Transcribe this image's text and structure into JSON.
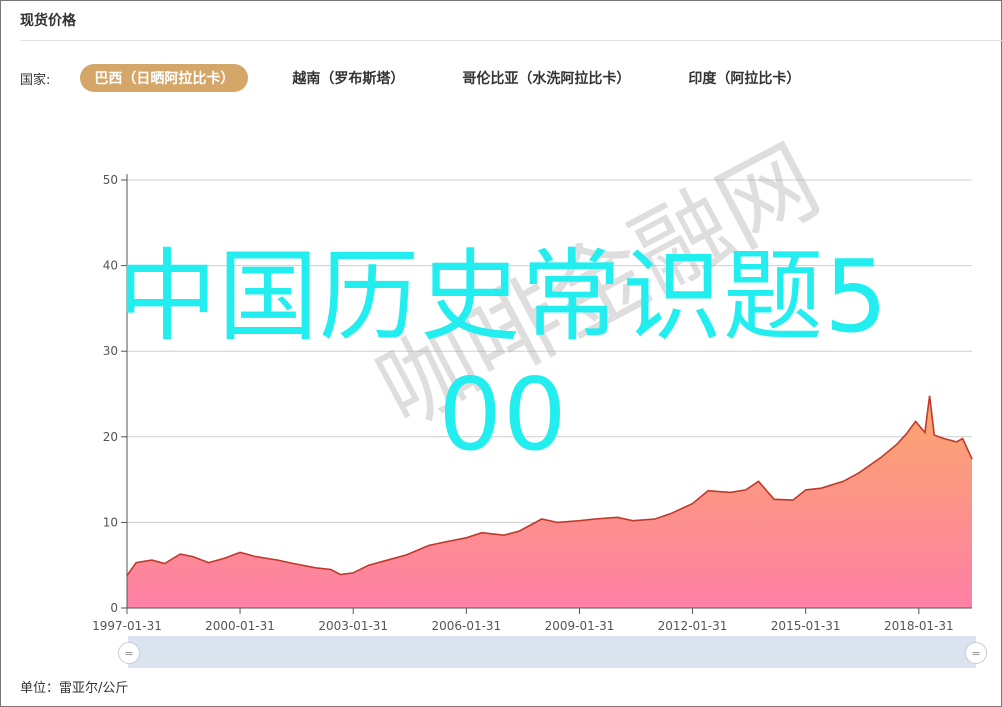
{
  "page": {
    "title": "现货价格",
    "filter_label": "国家:",
    "countries": [
      {
        "label": "巴西（日晒阿拉比卡）",
        "active": true
      },
      {
        "label": "越南（罗布斯塔）",
        "active": false
      },
      {
        "label": "哥伦比亚（水洗阿拉比卡）",
        "active": false
      },
      {
        "label": "印度（阿拉比卡）",
        "active": false
      }
    ],
    "unit": "单位：雷亚尔/公斤",
    "overlay_line1": "中国历史常识题5",
    "overlay_line2": "00",
    "watermark": "咖啡金融网"
  },
  "colors": {
    "accent": "#d4a668",
    "line": "#c0392b",
    "area_top": "#f9a76b",
    "area_bottom": "#ff7fa6",
    "overlay_text": "#22eef0"
  },
  "chart_data": {
    "type": "area",
    "ylim": [
      0,
      50
    ],
    "yticks": [
      0,
      10,
      20,
      30,
      40,
      50
    ],
    "xlim": [
      "1997-01-31",
      "2019-06-30"
    ],
    "xticks": [
      "1997-01-31",
      "2000-01-31",
      "2003-01-31",
      "2006-01-31",
      "2009-01-31",
      "2012-01-31",
      "2015-01-31",
      "2018-01-31"
    ],
    "points": [
      [
        "1997-01-31",
        3.8
      ],
      [
        "1997-04-30",
        5.3
      ],
      [
        "1997-09-30",
        5.6
      ],
      [
        "1998-01-31",
        5.2
      ],
      [
        "1998-06-30",
        6.3
      ],
      [
        "1998-10-31",
        6.0
      ],
      [
        "1999-03-31",
        5.3
      ],
      [
        "1999-08-31",
        5.8
      ],
      [
        "2000-01-31",
        6.5
      ],
      [
        "2000-06-30",
        6.0
      ],
      [
        "2001-01-31",
        5.6
      ],
      [
        "2001-06-30",
        5.2
      ],
      [
        "2002-01-31",
        4.7
      ],
      [
        "2002-06-30",
        4.5
      ],
      [
        "2002-09-30",
        3.9
      ],
      [
        "2003-01-31",
        4.1
      ],
      [
        "2003-06-30",
        5.0
      ],
      [
        "2004-01-31",
        5.7
      ],
      [
        "2004-06-30",
        6.2
      ],
      [
        "2005-01-31",
        7.3
      ],
      [
        "2005-06-30",
        7.7
      ],
      [
        "2006-01-31",
        8.2
      ],
      [
        "2006-06-30",
        8.8
      ],
      [
        "2007-01-31",
        8.5
      ],
      [
        "2007-06-30",
        9.0
      ],
      [
        "2008-01-31",
        10.4
      ],
      [
        "2008-06-30",
        10.0
      ],
      [
        "2009-01-31",
        10.2
      ],
      [
        "2009-06-30",
        10.4
      ],
      [
        "2010-01-31",
        10.6
      ],
      [
        "2010-06-30",
        10.2
      ],
      [
        "2011-01-31",
        10.4
      ],
      [
        "2011-06-30",
        11.0
      ],
      [
        "2012-01-31",
        12.2
      ],
      [
        "2012-06-30",
        13.7
      ],
      [
        "2013-01-31",
        13.5
      ],
      [
        "2013-06-30",
        13.8
      ],
      [
        "2013-10-31",
        14.8
      ],
      [
        "2014-03-31",
        12.7
      ],
      [
        "2014-09-30",
        12.6
      ],
      [
        "2015-01-31",
        13.8
      ],
      [
        "2015-06-30",
        14.0
      ],
      [
        "2016-01-31",
        14.8
      ],
      [
        "2016-06-30",
        15.8
      ],
      [
        "2017-01-31",
        17.6
      ],
      [
        "2017-06-30",
        19.1
      ],
      [
        "2017-09-30",
        20.3
      ],
      [
        "2017-12-31",
        21.8
      ],
      [
        "2018-03-31",
        20.5
      ],
      [
        "2018-05-15",
        24.8
      ],
      [
        "2018-06-30",
        20.2
      ],
      [
        "2018-09-30",
        19.8
      ],
      [
        "2019-01-31",
        19.4
      ],
      [
        "2019-03-31",
        19.8
      ],
      [
        "2019-05-31",
        18.2
      ],
      [
        "2019-06-30",
        17.4
      ]
    ]
  }
}
